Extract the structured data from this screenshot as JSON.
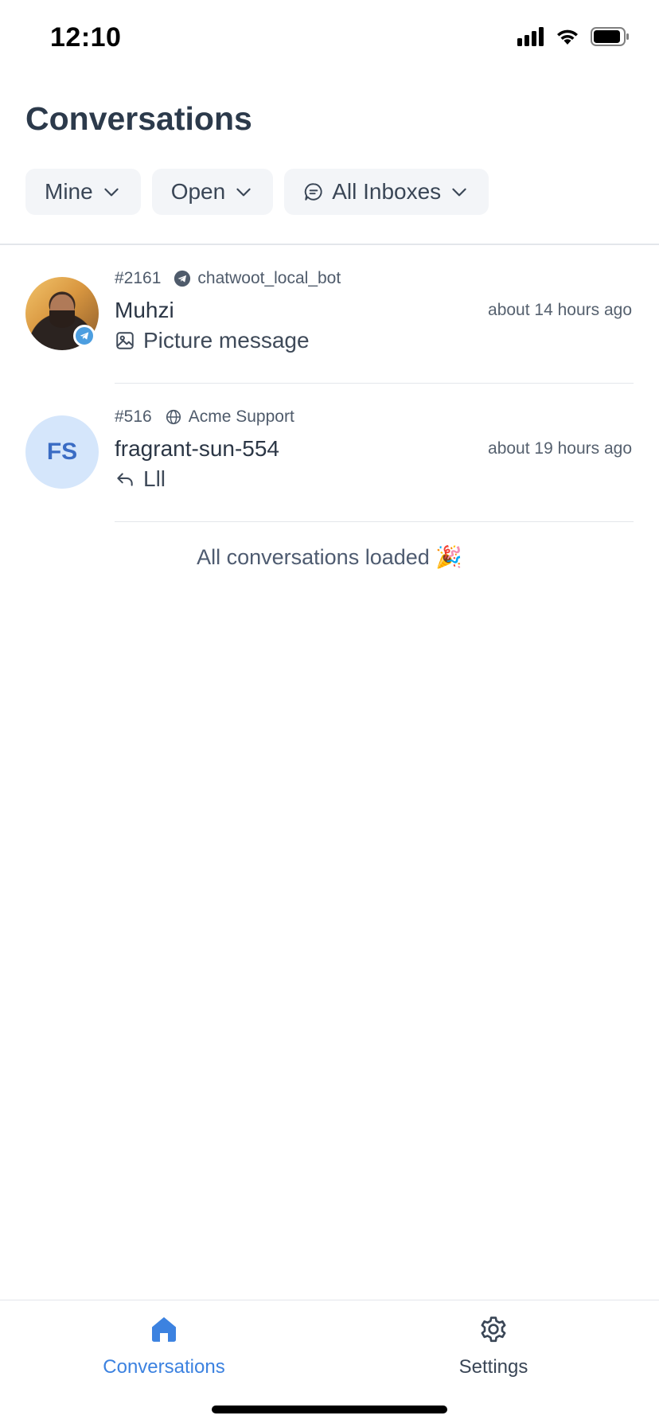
{
  "status_bar": {
    "time": "12:10"
  },
  "header": {
    "title": "Conversations"
  },
  "filters": [
    {
      "label": "Mine",
      "icon": "chevron-down-icon"
    },
    {
      "label": "Open",
      "icon": "chevron-down-icon"
    },
    {
      "label": "All Inboxes",
      "icon": "chat-bubble-icon"
    }
  ],
  "conversations": [
    {
      "id": "#2161",
      "inbox": "chatwoot_local_bot",
      "inbox_icon": "telegram-icon",
      "name": "Muhzi",
      "time": "about 14 hours ago",
      "preview": "Picture message",
      "preview_icon": "image-icon",
      "avatar": "photo",
      "channel_badge": "telegram-icon"
    },
    {
      "id": "#516",
      "inbox": "Acme Support",
      "inbox_icon": "globe-icon",
      "name": "fragrant-sun-554",
      "time": "about 19 hours ago",
      "preview": "Lll",
      "preview_icon": "reply-icon",
      "avatar_initials": "FS"
    }
  ],
  "list_footer": {
    "text": "All conversations loaded 🎉"
  },
  "tabbar": {
    "conversations_label": "Conversations",
    "settings_label": "Settings",
    "active_color": "#3c82e0"
  }
}
